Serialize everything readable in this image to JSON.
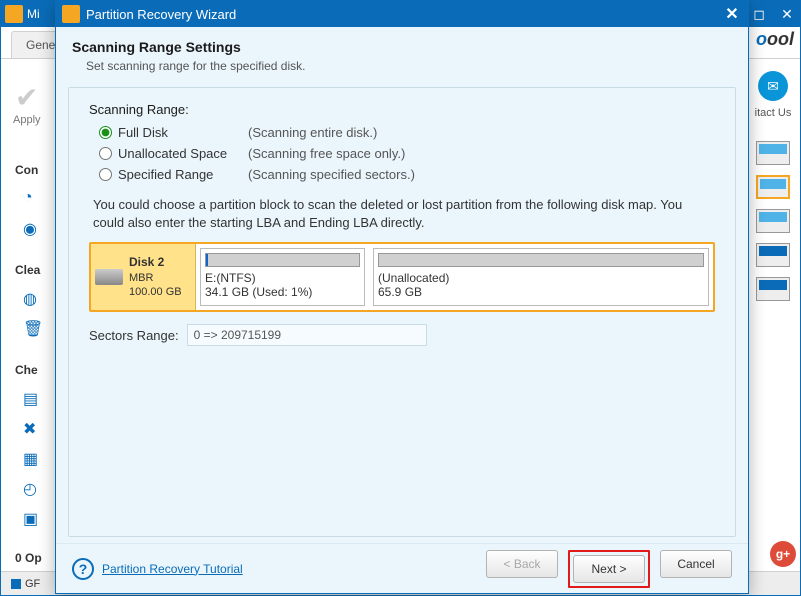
{
  "back": {
    "title_prefix": "Mi",
    "tab_general": "Genera",
    "apply_label": "Apply",
    "brand_suffix": "ool",
    "contact_label": "itact Us",
    "section_convert": "Con",
    "section_cleanup": "Clea",
    "section_check": "Che",
    "ops_label": "0 Op",
    "status_prefix": "GF"
  },
  "wizard": {
    "title": "Partition Recovery Wizard",
    "heading": "Scanning Range Settings",
    "subheading": "Set scanning range for the specified disk.",
    "range_label": "Scanning Range:",
    "options": [
      {
        "label": "Full Disk",
        "desc": "(Scanning entire disk.)"
      },
      {
        "label": "Unallocated Space",
        "desc": "(Scanning free space only.)"
      },
      {
        "label": "Specified Range",
        "desc": "(Scanning specified sectors.)"
      }
    ],
    "hint": "You could choose a partition block to scan the deleted or lost partition from the following disk map. You could also enter the starting LBA and Ending LBA directly.",
    "disk": {
      "name": "Disk 2",
      "type": "MBR",
      "size": "100.00 GB"
    },
    "part1": {
      "label": "E:(NTFS)",
      "size": "34.1 GB (Used: 1%)",
      "used_pct": 1
    },
    "part2": {
      "label": "(Unallocated)",
      "size": "65.9 GB"
    },
    "sectors_label": "Sectors Range:",
    "sectors_value": "0 => 209715199",
    "tutorial": "Partition Recovery Tutorial",
    "btn_back": "< Back",
    "btn_next": "Next >",
    "btn_cancel": "Cancel"
  }
}
